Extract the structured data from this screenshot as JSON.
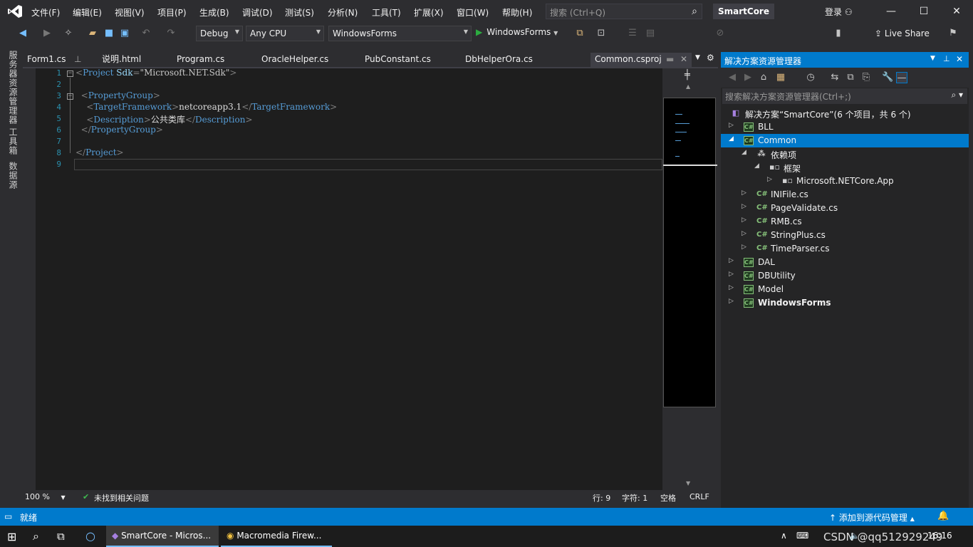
{
  "menubar": {
    "items": [
      "文件(F)",
      "编辑(E)",
      "视图(V)",
      "项目(P)",
      "生成(B)",
      "调试(D)",
      "测试(S)",
      "分析(N)",
      "工具(T)",
      "扩展(X)",
      "窗口(W)",
      "帮助(H)"
    ],
    "search_placeholder": "搜索 (Ctrl+Q)",
    "solution_name": "SmartCore",
    "login": "登录"
  },
  "toolbar": {
    "config": "Debug",
    "platform": "Any CPU",
    "startup_project": "WindowsForms",
    "run_label": "WindowsForms",
    "liveshare": "Live Share"
  },
  "left_strip": [
    "服务器资源管理器",
    "工具箱",
    "数据源"
  ],
  "tabs": [
    "Form1.cs",
    "说明.html",
    "Program.cs",
    "OracleHelper.cs",
    "PubConstant.cs",
    "DbHelperOra.cs",
    "Common.csproj"
  ],
  "editor": {
    "line_numbers": [
      "1",
      "2",
      "3",
      "4",
      "5",
      "6",
      "7",
      "8",
      "9"
    ],
    "lines": {
      "l1_tag": "Project",
      "l1_attr": "Sdk",
      "l1_val": "\"Microsoft.NET.Sdk\"",
      "l3_tag": "PropertyGroup",
      "l4_tag": "TargetFramework",
      "l4_text": "netcoreapp3.1",
      "l5_tag": "Description",
      "l5_text": "公共类库"
    }
  },
  "editor_status": {
    "zoom": "100 %",
    "issues": "未找到相关问题",
    "line": "行: 9",
    "col": "字符: 1",
    "spaces": "空格",
    "eol": "CRLF"
  },
  "solution_explorer": {
    "title": "解决方案资源管理器",
    "search_placeholder": "搜索解决方案资源管理器(Ctrl+;)",
    "solution_label": "解决方案“SmartCore”(6 个项目，共 6 个)",
    "items": [
      {
        "label": "BLL",
        "type": "project"
      },
      {
        "label": "Common",
        "type": "project"
      },
      {
        "label": "依赖项",
        "type": "dependency"
      },
      {
        "label": "框架",
        "type": "dependency"
      },
      {
        "label": "Microsoft.NETCore.App",
        "type": "dependency"
      },
      {
        "label": "INIFile.cs",
        "type": "cs"
      },
      {
        "label": "PageValidate.cs",
        "type": "cs"
      },
      {
        "label": "RMB.cs",
        "type": "cs"
      },
      {
        "label": "StringPlus.cs",
        "type": "cs"
      },
      {
        "label": "TimeParser.cs",
        "type": "cs"
      },
      {
        "label": "DAL",
        "type": "project"
      },
      {
        "label": "DBUtility",
        "type": "project"
      },
      {
        "label": "Model",
        "type": "project"
      },
      {
        "label": "WindowsForms",
        "type": "project"
      }
    ]
  },
  "statusbar": {
    "ready": "就绪",
    "source_control": "添加到源代码管理"
  },
  "taskbar": {
    "items": [
      "SmartCore - Micros...",
      "Macromedia Firew..."
    ],
    "time": "16:16",
    "watermark": "CSDN @qq512929249"
  },
  "colors": {
    "accent": "#007acc",
    "editor_bg": "#1e1e1e",
    "chrome_bg": "#2d2d30"
  }
}
